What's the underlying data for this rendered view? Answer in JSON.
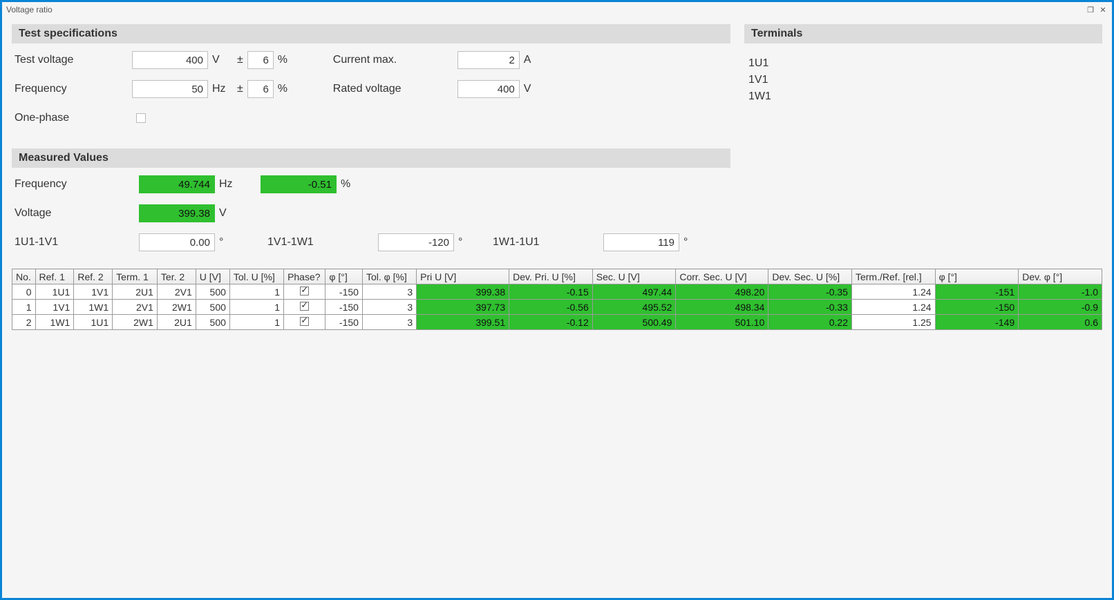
{
  "window": {
    "title": "Voltage ratio"
  },
  "sections": {
    "spec_header": "Test specifications",
    "terminals_header": "Terminals",
    "measured_header": "Measured Values"
  },
  "spec": {
    "test_voltage_label": "Test voltage",
    "test_voltage": "400",
    "test_voltage_unit": "V",
    "pm": "±",
    "test_voltage_tol": "6",
    "pct": "%",
    "current_max_label": "Current max.",
    "current_max": "2",
    "current_max_unit": "A",
    "frequency_label": "Frequency",
    "frequency": "50",
    "frequency_unit": "Hz",
    "frequency_tol": "6",
    "rated_voltage_label": "Rated voltage",
    "rated_voltage": "400",
    "rated_voltage_unit": "V",
    "one_phase_label": "One-phase"
  },
  "terminals": [
    "1U1",
    "1V1",
    "1W1"
  ],
  "measured": {
    "frequency_label": "Frequency",
    "frequency": "49.744",
    "frequency_unit": "Hz",
    "frequency_dev": "-0.51",
    "pct": "%",
    "voltage_label": "Voltage",
    "voltage": "399.38",
    "voltage_unit": "V",
    "p1_label": "1U1-1V1",
    "p1": "0.00",
    "deg": "°",
    "p2_label": "1V1-1W1",
    "p2": "-120",
    "p3_label": "1W1-1U1",
    "p3": "119"
  },
  "table": {
    "headers": [
      "No.",
      "Ref. 1",
      "Ref. 2",
      "Term. 1",
      "Ter. 2",
      "U [V]",
      "Tol. U [%]",
      "Phase?",
      "φ [°]",
      "Tol. φ [%]",
      "Pri U [V]",
      "Dev. Pri. U [%]",
      "Sec. U [V]",
      "Corr. Sec. U [V]",
      "Dev. Sec. U [%]",
      "Term./Ref. [rel.]",
      "φ [°]",
      "Dev. φ [°]"
    ],
    "rows": [
      {
        "no": "0",
        "r1": "1U1",
        "r2": "1V1",
        "t1": "2U1",
        "t2": "2V1",
        "u": "500",
        "tolu": "1",
        "ph": true,
        "phi": "-150",
        "tolphi": "3",
        "priu": "399.38",
        "devpri": "-0.15",
        "secu": "497.44",
        "corrsec": "498.20",
        "devsec": "-0.35",
        "termrel": "1.24",
        "phi2": "-151",
        "devphi": "-1.0"
      },
      {
        "no": "1",
        "r1": "1V1",
        "r2": "1W1",
        "t1": "2V1",
        "t2": "2W1",
        "u": "500",
        "tolu": "1",
        "ph": true,
        "phi": "-150",
        "tolphi": "3",
        "priu": "397.73",
        "devpri": "-0.56",
        "secu": "495.52",
        "corrsec": "498.34",
        "devsec": "-0.33",
        "termrel": "1.24",
        "phi2": "-150",
        "devphi": "-0.9"
      },
      {
        "no": "2",
        "r1": "1W1",
        "r2": "1U1",
        "t1": "2W1",
        "t2": "2U1",
        "u": "500",
        "tolu": "1",
        "ph": true,
        "phi": "-150",
        "tolphi": "3",
        "priu": "399.51",
        "devpri": "-0.12",
        "secu": "500.49",
        "corrsec": "501.10",
        "devsec": "0.22",
        "termrel": "1.25",
        "phi2": "-149",
        "devphi": "0.6"
      }
    ]
  }
}
